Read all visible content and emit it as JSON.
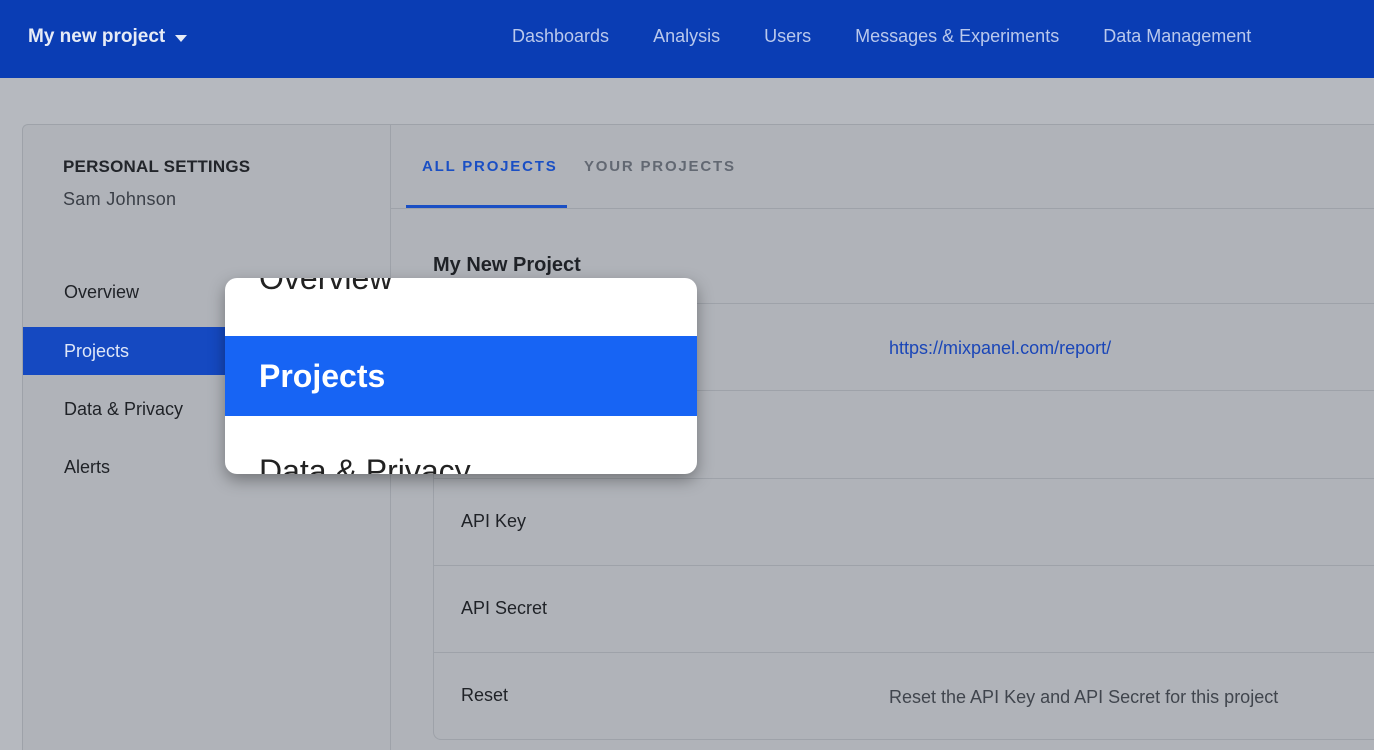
{
  "topbar": {
    "project_name": "My new project",
    "nav": [
      "Dashboards",
      "Analysis",
      "Users",
      "Messages & Experiments",
      "Data Management"
    ]
  },
  "sidebar": {
    "heading": "PERSONAL SETTINGS",
    "username": "Sam Johnson",
    "items": [
      {
        "label": "Overview"
      },
      {
        "label": "Projects"
      },
      {
        "label": "Data & Privacy"
      },
      {
        "label": "Alerts"
      }
    ]
  },
  "tabs": [
    {
      "label": "ALL PROJECTS"
    },
    {
      "label": "YOUR PROJECTS"
    }
  ],
  "project": {
    "title": "My New Project",
    "rows": [
      {
        "label": "",
        "value": "https://mixpanel.com/report/"
      },
      {
        "label": "",
        "value": ""
      },
      {
        "label": "API Key",
        "value": ""
      },
      {
        "label": "API Secret",
        "value": ""
      },
      {
        "label": "Reset",
        "value": "Reset the API Key and API Secret for this project"
      }
    ]
  },
  "zoom": {
    "items": [
      "Overview",
      "Projects",
      "Data & Privacy"
    ]
  },
  "colors": {
    "topbar": "#0a3db4",
    "accent": "#1549c1",
    "zoom_highlight": "#1764f4"
  }
}
